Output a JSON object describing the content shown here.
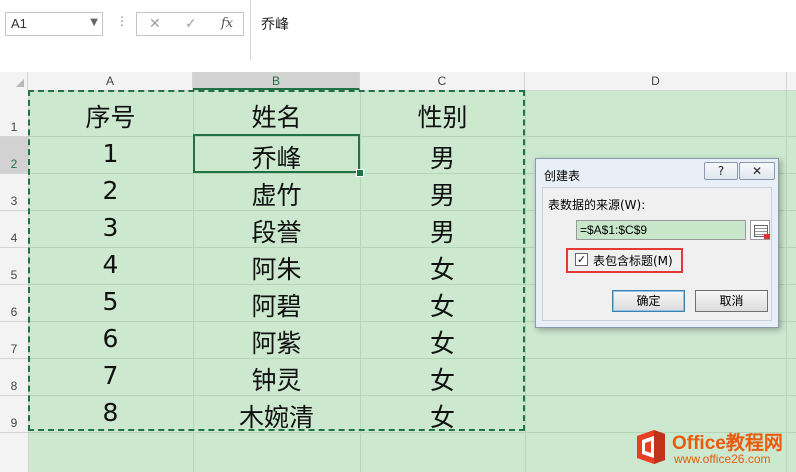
{
  "name_box": {
    "value": "A1"
  },
  "formula_bar": {
    "cancel_icon": "✕",
    "enter_icon": "✓",
    "fx_label": "fx",
    "value": "乔峰"
  },
  "columns": [
    "A",
    "B",
    "C",
    "D"
  ],
  "rows": [
    "1",
    "2",
    "3",
    "4",
    "5",
    "6",
    "7",
    "8",
    "9"
  ],
  "table": {
    "headers": [
      "序号",
      "姓名",
      "性别"
    ],
    "rows": [
      [
        "1",
        "乔峰",
        "男"
      ],
      [
        "2",
        "虚竹",
        "男"
      ],
      [
        "3",
        "段誉",
        "男"
      ],
      [
        "4",
        "阿朱",
        "女"
      ],
      [
        "5",
        "阿碧",
        "女"
      ],
      [
        "6",
        "阿紫",
        "女"
      ],
      [
        "7",
        "钟灵",
        "女"
      ],
      [
        "8",
        "木婉清",
        "女"
      ]
    ]
  },
  "dialog": {
    "title": "创建表",
    "help": "?",
    "close": "✕",
    "source_label": "表数据的来源(W):",
    "range_value": "=$A$1:$C$9",
    "checkbox_mark": "✓",
    "checkbox_label": "表包含标题(M)",
    "checkbox_checked": true,
    "ok": "确定",
    "cancel": "取消"
  },
  "watermark": {
    "brand": "Office教程网",
    "url": "www.office26.com"
  },
  "colors": {
    "accent": "#217346",
    "sheet_bg": "#cce8cf",
    "highlight": "#e53935",
    "watermark": "#ea5b0c"
  }
}
